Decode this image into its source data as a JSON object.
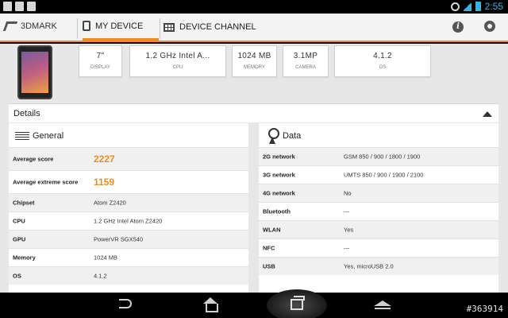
{
  "status": {
    "time": "2:55"
  },
  "appbar": {
    "app_name": "3DMARK",
    "tabs": [
      {
        "label": "MY DEVICE",
        "active": true,
        "icon": "tablet-icon"
      },
      {
        "label": "DEVICE CHANNEL",
        "active": false,
        "icon": "grid-icon"
      }
    ],
    "info_icon_glyph": "i"
  },
  "specs": [
    {
      "value": "7\"",
      "label": "DISPLAY"
    },
    {
      "value": "1.2 GHz Intel A...",
      "label": "CPU"
    },
    {
      "value": "1024 MB",
      "label": "MEMORY"
    },
    {
      "value": "3.1MP",
      "label": "CAMERA"
    },
    {
      "value": "4.1.2",
      "label": "OS"
    }
  ],
  "details": {
    "title": "Details"
  },
  "general": {
    "title": "General",
    "rows": [
      {
        "key": "Average score",
        "value": "2227"
      },
      {
        "key": "Average extreme score",
        "value": "1159"
      },
      {
        "key": "Chipset",
        "value": "Atom Z2420"
      },
      {
        "key": "CPU",
        "value": "1.2 GHz Intel Atom Z2420"
      },
      {
        "key": "GPU",
        "value": "PowerVR SGX540"
      },
      {
        "key": "Memory",
        "value": "1024 MB"
      },
      {
        "key": "OS",
        "value": "4.1.2"
      }
    ]
  },
  "data": {
    "title": "Data",
    "rows": [
      {
        "key": "2G network",
        "value": "GSM 850 / 900 / 1800 / 1900"
      },
      {
        "key": "3G network",
        "value": "UMTS 850 / 900 / 1900 / 2100"
      },
      {
        "key": "4G network",
        "value": "No"
      },
      {
        "key": "Bluetooth",
        "value": "---"
      },
      {
        "key": "WLAN",
        "value": "Yes"
      },
      {
        "key": "NFC",
        "value": "---"
      },
      {
        "key": "USB",
        "value": "Yes, microUSB 2.0"
      }
    ]
  },
  "watermark": "#363914",
  "colors": {
    "accent": "#f08a24",
    "status_blue": "#33b5e5"
  }
}
